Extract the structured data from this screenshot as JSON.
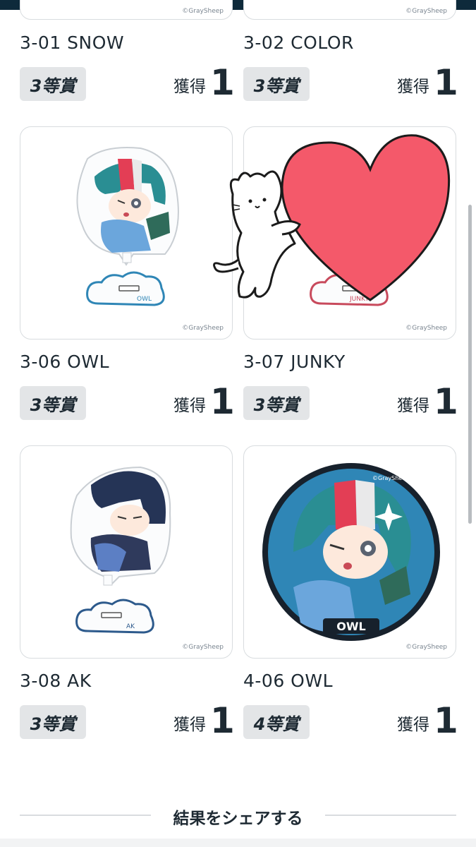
{
  "top_cards_partial": [
    {
      "copyright": "©GraySheep"
    },
    {
      "copyright": "©GraySheep"
    }
  ],
  "prize_label_acquired": "獲得",
  "items": [
    {
      "code_name": "3-01 SNOW",
      "rank": "3等賞",
      "count": "1",
      "has_card": false
    },
    {
      "code_name": "3-02 COLOR",
      "rank": "3等賞",
      "count": "1",
      "has_card": false
    },
    {
      "code_name": "3-06 OWL",
      "rank": "3等賞",
      "count": "1",
      "copyright": "©GraySheep",
      "stand_label": "OWL",
      "type": "acrylic-stand",
      "character": "owl"
    },
    {
      "code_name": "3-07 JUNKY",
      "rank": "3等賞",
      "count": "1",
      "copyright": "©GraySheep",
      "stand_label": "JUNKY",
      "type": "acrylic-stand",
      "character": "junky"
    },
    {
      "code_name": "3-08 AK",
      "rank": "3等賞",
      "count": "1",
      "copyright": "©GraySheep",
      "stand_label": "AK",
      "type": "acrylic-stand",
      "character": "ak"
    },
    {
      "code_name": "4-06 OWL",
      "rank": "4等賞",
      "count": "1",
      "copyright": "©GraySheep",
      "stand_label": "OWL",
      "type": "can-badge",
      "character": "owl"
    }
  ],
  "share": {
    "label": "結果をシェアする"
  },
  "colors": {
    "topbar": "#0e2a3b",
    "badge_bg": "#e3e5e7",
    "heart": "#f4596a",
    "owl_hair_teal": "#2a8e93",
    "owl_hair_red": "#e33e55",
    "badge_blue": "#2f86b6"
  }
}
